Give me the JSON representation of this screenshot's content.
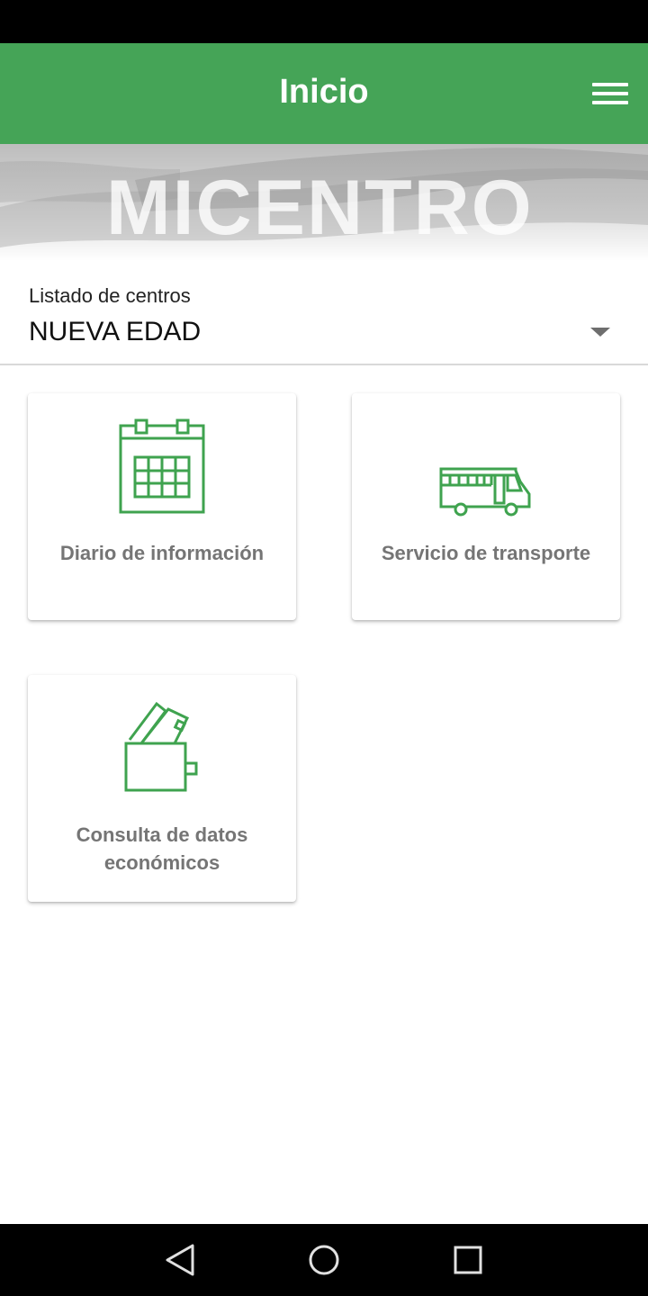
{
  "app_bar": {
    "title": "Inicio",
    "menu_icon": "hamburger-menu-icon",
    "background_color": "#45a457"
  },
  "banner": {
    "logo_text": "MICENTRO"
  },
  "center_select": {
    "label": "Listado de centros",
    "value": "NUEVA EDAD",
    "icon": "dropdown-arrow-icon"
  },
  "tiles": [
    {
      "label": "Diario de información",
      "icon": "calendar-icon"
    },
    {
      "label": "Servicio de transporte",
      "icon": "bus-icon"
    },
    {
      "label": "Consulta de datos económicos",
      "icon": "wallet-icon"
    }
  ],
  "nav_bar": {
    "icons": [
      "back-icon",
      "home-icon",
      "recent-apps-icon"
    ]
  },
  "accent_color": "#3fa34f"
}
